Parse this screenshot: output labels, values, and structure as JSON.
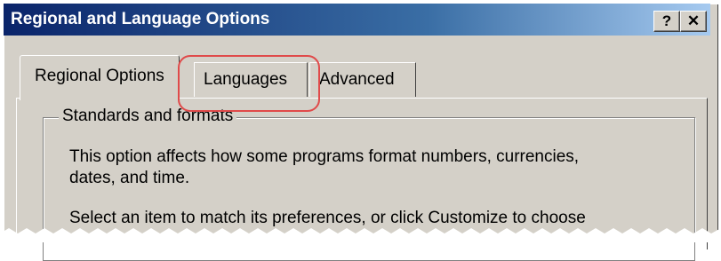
{
  "window": {
    "title": "Regional and Language Options",
    "help_button": "?",
    "close_button": "✕"
  },
  "tabs": [
    {
      "label": "Regional Options",
      "selected": true
    },
    {
      "label": "Languages",
      "selected": false,
      "highlighted": true
    },
    {
      "label": "Advanced",
      "selected": false
    }
  ],
  "groupbox": {
    "title": "Standards and formats",
    "line1": "This option affects how some programs format numbers, currencies,",
    "line2": "dates, and time.",
    "line3": "Select an item to match its preferences, or click Customize to choose"
  },
  "colors": {
    "titlebar_dark": "#0a246a",
    "titlebar_light": "#a6caf0",
    "dialog_bg": "#d4d0c8",
    "highlight_ring": "#e04a4a"
  }
}
